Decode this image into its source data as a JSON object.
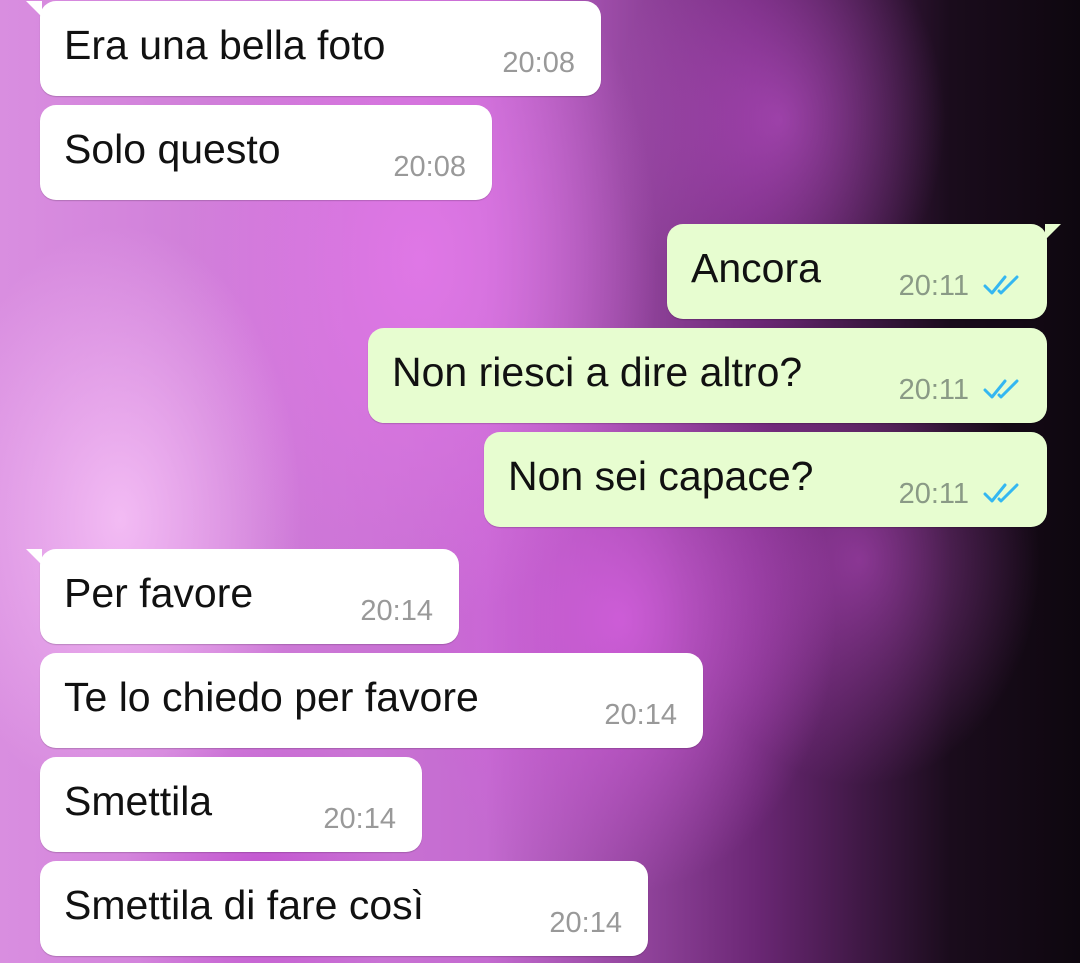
{
  "chat": {
    "messages": [
      {
        "direction": "incoming",
        "text": "Era una bella foto",
        "time": "20:08"
      },
      {
        "direction": "incoming",
        "text": "Solo questo",
        "time": "20:08"
      },
      {
        "direction": "outgoing",
        "text": "Ancora",
        "time": "20:11",
        "status": "read"
      },
      {
        "direction": "outgoing",
        "text": "Non riesci a dire altro?",
        "time": "20:11",
        "status": "read"
      },
      {
        "direction": "outgoing",
        "text": "Non sei capace?",
        "time": "20:11",
        "status": "read"
      },
      {
        "direction": "incoming",
        "text": "Per favore",
        "time": "20:14"
      },
      {
        "direction": "incoming",
        "text": "Te lo chiedo per favore",
        "time": "20:14"
      },
      {
        "direction": "incoming",
        "text": "Smettila",
        "time": "20:14"
      },
      {
        "direction": "incoming",
        "text": "Smettila di fare così",
        "time": "20:14"
      }
    ]
  },
  "colors": {
    "incoming_bubble": "#ffffff",
    "outgoing_bubble": "#e7fdd0",
    "read_ticks": "#34b7f1"
  },
  "icons": {
    "read_receipt": "double-check-icon"
  }
}
